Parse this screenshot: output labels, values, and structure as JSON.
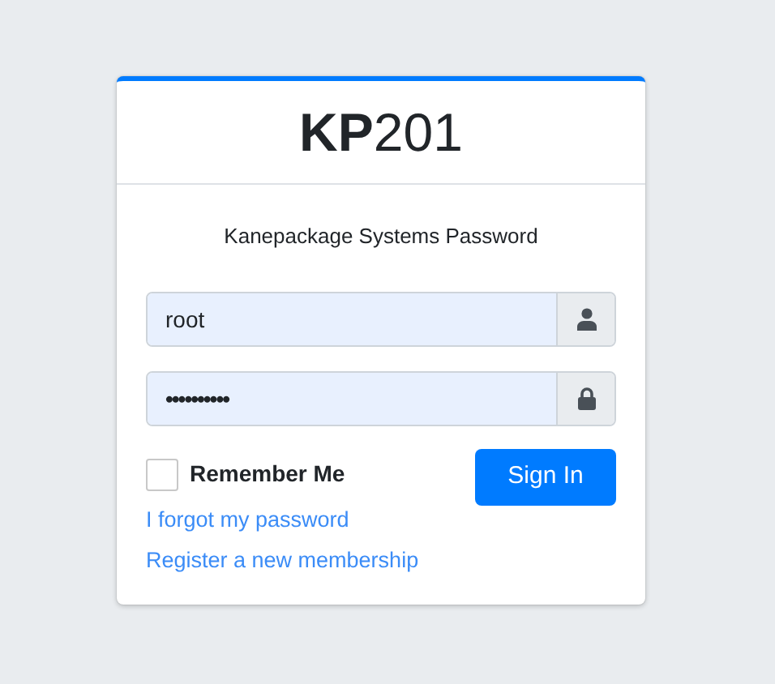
{
  "logo": "**KP**201",
  "subtitle": "Kanepackage Systems Password",
  "fields": [
    {
      "kind": "username",
      "value": "root"
    },
    {
      "kind": "password",
      "value": "••••••••••"
    }
  ],
  "remember": {
    "label": "Remember Me",
    "checked": false
  },
  "sign_in": "Sign In",
  "links": [
    "I forgot my password",
    "Register a new membership"
  ]
}
